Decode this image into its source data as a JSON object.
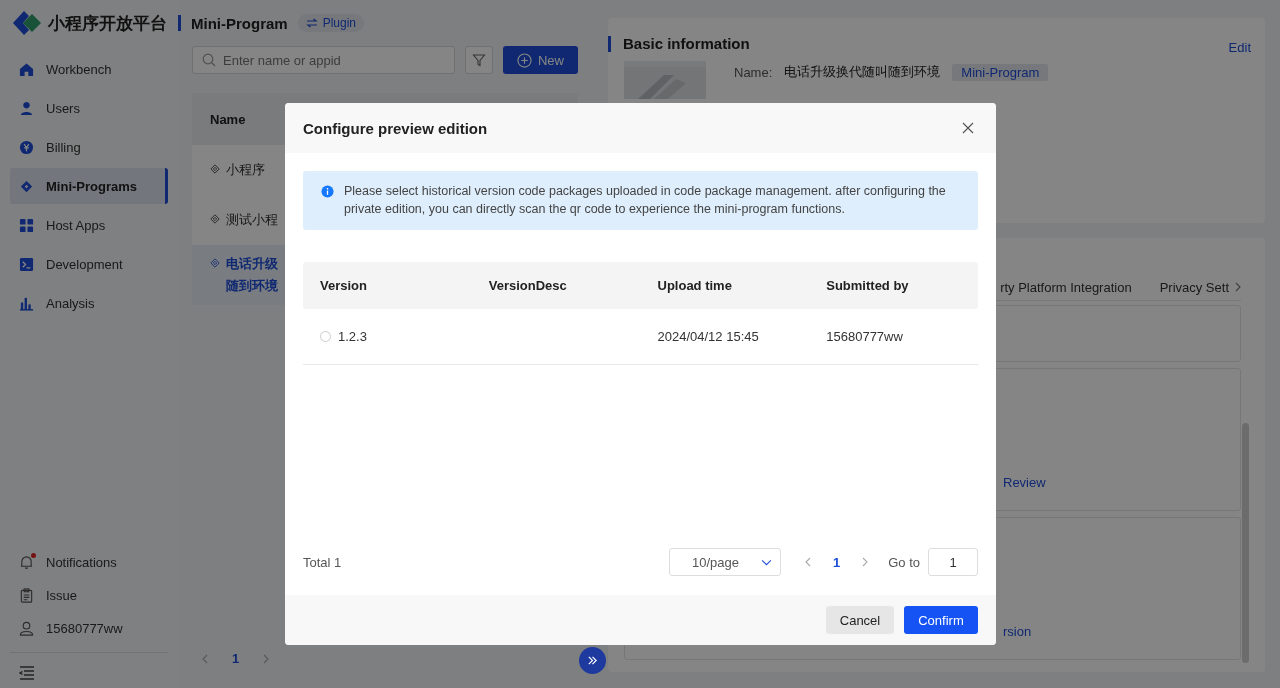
{
  "brand": {
    "name": "小程序开放平台"
  },
  "header": {
    "title": "Mini-Program",
    "tag": "Plugin"
  },
  "sidebar": {
    "items": [
      {
        "label": "Workbench",
        "kind": "home",
        "selected": false
      },
      {
        "label": "Users",
        "kind": "user",
        "selected": false
      },
      {
        "label": "Billing",
        "kind": "coin",
        "selected": false
      },
      {
        "label": "Mini-Programs",
        "kind": "diamond",
        "selected": true
      },
      {
        "label": "Host Apps",
        "kind": "grid",
        "selected": false
      },
      {
        "label": "Development",
        "kind": "terminal",
        "selected": false
      },
      {
        "label": "Analysis",
        "kind": "chart",
        "selected": false
      }
    ],
    "bottom": [
      {
        "label": "Notifications",
        "kind": "bell",
        "unread": true
      },
      {
        "label": "Issue",
        "kind": "clipboard",
        "unread": false
      },
      {
        "label": "15680777ww",
        "kind": "person",
        "unread": false
      }
    ]
  },
  "list": {
    "search": {
      "placeholder": "Enter name or appid"
    },
    "new_button": "New",
    "column": "Name",
    "rows": [
      {
        "lines": [
          "小程序"
        ],
        "selected": false
      },
      {
        "lines": [
          "测试小程"
        ],
        "selected": false
      },
      {
        "lines": [
          "电话升级",
          "随到环境"
        ],
        "selected": true
      }
    ],
    "page": "1"
  },
  "detail": {
    "title": "Basic information",
    "edit": "Edit",
    "name_label": "Name:",
    "name_value": "电话升级换代随叫随到环境",
    "type_tag": "Mini-Program",
    "tabs": [
      "rty Platform Integration",
      "Privacy Sett"
    ],
    "links": [
      "Review",
      "rsion"
    ]
  },
  "modal": {
    "title": "Configure preview edition",
    "notice": "Please select historical version code packages uploaded in code package management. after configuring the private edition, you can directly scan the qr code to experience the mini-program functions.",
    "columns": [
      "Version",
      "VersionDesc",
      "Upload time",
      "Submitted by"
    ],
    "rows": [
      {
        "version": "1.2.3",
        "time": "2024/04/12 15:45",
        "by": "15680777ww",
        "selected": false
      }
    ],
    "total": "Total 1",
    "page_size": "10/page",
    "page": "1",
    "goto_label": "Go to",
    "goto_value": "1",
    "cancel": "Cancel",
    "confirm": "Confirm"
  }
}
